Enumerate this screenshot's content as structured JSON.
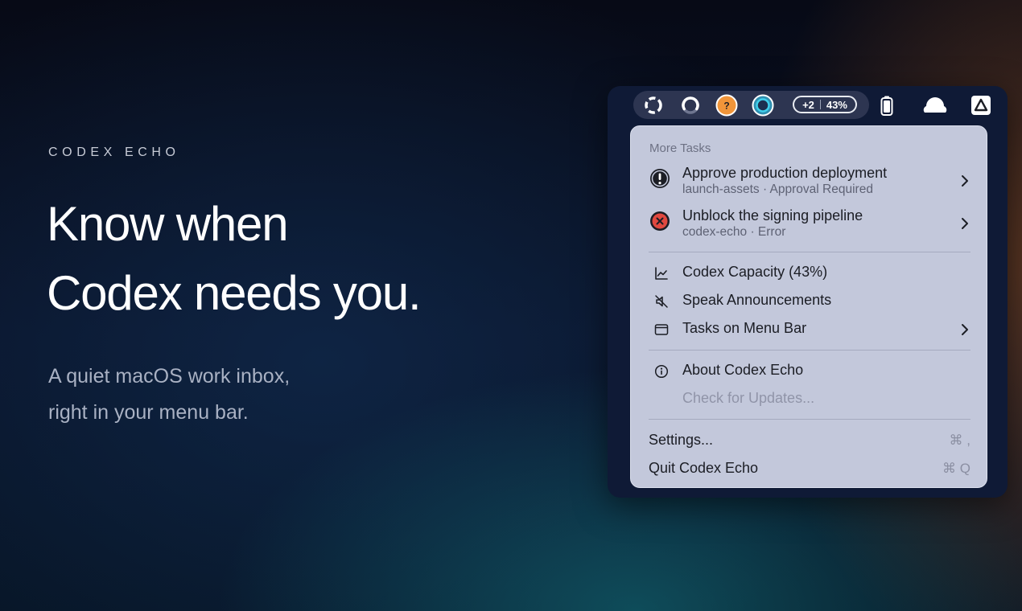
{
  "hero": {
    "eyebrow": "CODEX ECHO",
    "headline": [
      "Know when",
      "Codex needs you."
    ],
    "subline": [
      "A quiet macOS work inbox,",
      "right in your menu bar."
    ]
  },
  "menubar": {
    "status_icons": [
      "spinner-segmented-icon",
      "spinner-arc-icon",
      "question-badge-icon",
      "active-ring-icon"
    ],
    "question_badge_text": "?",
    "pill": {
      "count": "+2",
      "percent": "43%"
    },
    "system_icons": [
      "battery-icon",
      "cloud-icon",
      "triangle-logo-icon"
    ]
  },
  "menu": {
    "section_title": "More Tasks",
    "tasks": [
      {
        "title": "Approve production deployment",
        "subtitle": "launch-assets · Approval Required",
        "status": "approval",
        "icon": "exclamation-circle-icon"
      },
      {
        "title": "Unblock the signing pipeline",
        "subtitle": "codex-echo · Error",
        "status": "error",
        "icon": "error-x-circle-icon"
      }
    ],
    "options": [
      {
        "label": "Codex Capacity (43%)",
        "icon": "line-chart-icon"
      },
      {
        "label": "Speak Announcements",
        "icon": "speaker-muted-icon"
      },
      {
        "label": "Tasks on Menu Bar",
        "icon": "menubar-window-icon",
        "submenu": true
      }
    ],
    "app_items": [
      {
        "label": "About Codex Echo",
        "icon": "info-circle-icon"
      },
      {
        "label": "Check for Updates...",
        "disabled": true
      }
    ],
    "commands": [
      {
        "label": "Settings...",
        "shortcut": "⌘ ,"
      },
      {
        "label": "Quit Codex Echo",
        "shortcut": "⌘ Q"
      }
    ]
  },
  "colors": {
    "menu_bg": "#c3c8db",
    "approval": "#1b1d24",
    "error": "#e0483f",
    "question_badge": "#f0953a",
    "active_ring": "#3aa9c9"
  }
}
